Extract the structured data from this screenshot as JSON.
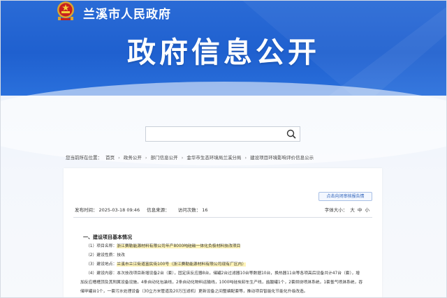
{
  "header": {
    "site_name": "兰溪市人民政府",
    "hero_title": "政府信息公开"
  },
  "search": {
    "placeholder": ""
  },
  "breadcrumb": {
    "prefix": "您当前所在位置：",
    "items": [
      "首页",
      "政务公开",
      "部门信息公开",
      "金华市生态环境局兰溪分局",
      "建设项目环境影响评价信息公示"
    ],
    "separator": "›"
  },
  "article": {
    "tag_button": "点击向闭审核报告情",
    "publish_label": "发布时间：",
    "publish_time": "2025-03-18 09:46",
    "source_label": "信息来源：",
    "source": "",
    "visits_label": "访问次数：",
    "visits": "16",
    "font_label": "字体大小：",
    "font_sizes": [
      "大",
      "中",
      "小"
    ],
    "section_title": "一、建设项目基本情况",
    "lines": [
      {
        "prefix": "（1）项目名称：",
        "text": "浙江赛勒能源材料有限公司年产8000吨硅碳一体化负极材料技改项目"
      },
      {
        "prefix": "（2）建设性质：",
        "text": "技改"
      },
      {
        "prefix": "（3）建设地点：",
        "text": "兰溪市兰江街道富民街100号（浙江赛勒能源材料有限公司现有厂区内）"
      },
      {
        "prefix": "（4）建设内容：",
        "text": "本次技改项目新增设备2台（套），固定床反应器8台，储罐2台过滤器10台等数据10台，换热器11台等各项高后设备共计47台（套），增"
      },
      {
        "prefix": "",
        "text": "加反应槽槽顶及其附属设备设施，4条自动化包装线，2条自动化物料运输线，1000吨硅炭卸车生产线，盐酸罐1个，2套烘烧喷淋系统，1套氢气喷淋系统，吞"
      },
      {
        "prefix": "",
        "text": "储甲罐台1个，一套污水处理设备（30立方米管道及20万压滤机）更新设备之间整编配套等，推动项目智能化节能化升级改造。"
      }
    ]
  }
}
